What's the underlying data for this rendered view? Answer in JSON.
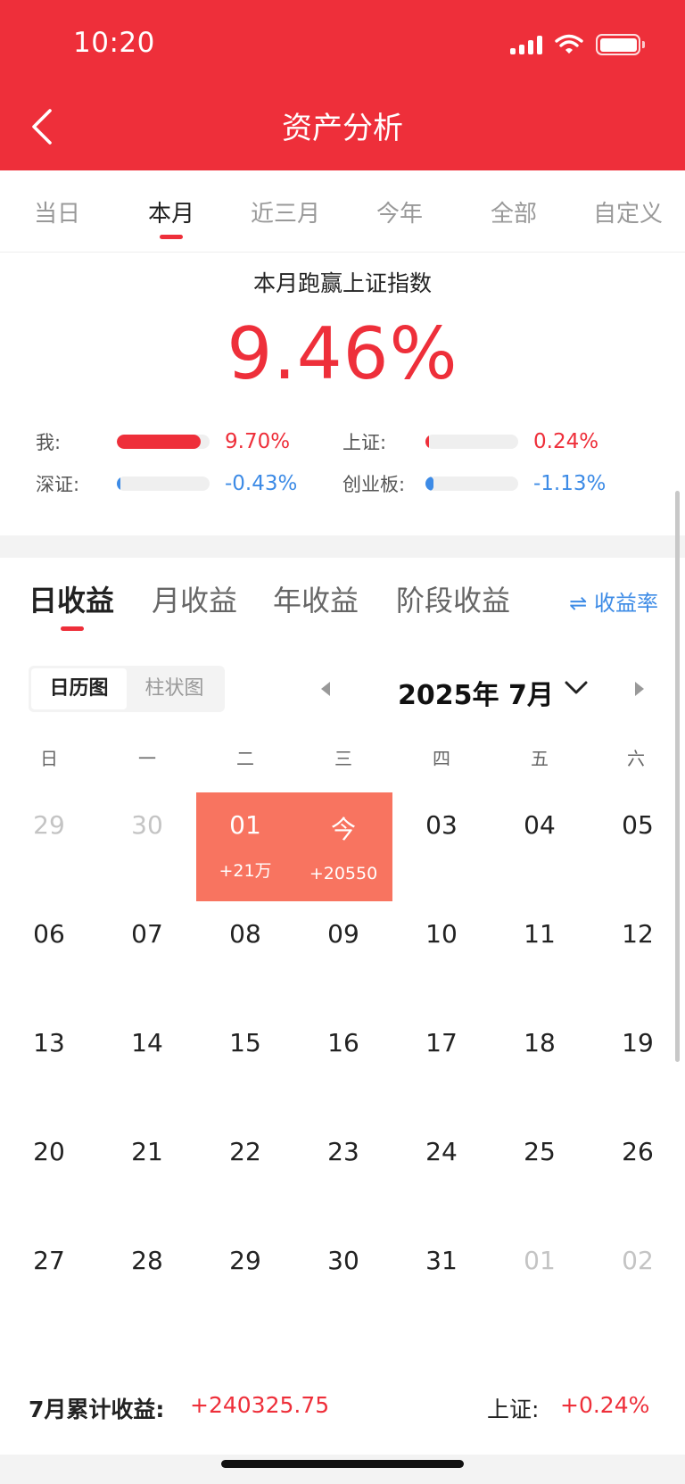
{
  "status_bar": {
    "time": "10:20"
  },
  "nav": {
    "title": "资产分析"
  },
  "period_tabs": [
    "当日",
    "本月",
    "近三月",
    "今年",
    "全部",
    "自定义"
  ],
  "summary": {
    "title": "本月跑赢上证指数",
    "value": "9.46%"
  },
  "comparisons": [
    {
      "label": "我:",
      "value": "9.70%",
      "fraction": 0.9,
      "color": "#ee2f3a"
    },
    {
      "label": "上证:",
      "value": "0.24%",
      "fraction": 0.03,
      "color": "#ee2f3a"
    },
    {
      "label": "深证:",
      "value": "-0.43%",
      "fraction": 0.03,
      "color": "#3d8be6"
    },
    {
      "label": "创业板:",
      "value": "-1.13%",
      "fraction": 0.09,
      "color": "#3d8be6"
    }
  ],
  "profit_tabs": [
    "日收益",
    "月收益",
    "年收益",
    "阶段收益"
  ],
  "rate_toggle": "⇌ 收益率",
  "view_switch": [
    "日历图",
    "柱状图"
  ],
  "calendar": {
    "month_label": "2025年 7月",
    "weekdays": [
      "日",
      "一",
      "二",
      "三",
      "四",
      "五",
      "六"
    ],
    "weeks": [
      [
        "29",
        "30",
        "01",
        "今",
        "03",
        "04",
        "05"
      ],
      [
        "06",
        "07",
        "08",
        "09",
        "10",
        "11",
        "12"
      ],
      [
        "13",
        "14",
        "15",
        "16",
        "17",
        "18",
        "19"
      ],
      [
        "20",
        "21",
        "22",
        "23",
        "24",
        "25",
        "26"
      ],
      [
        "27",
        "28",
        "29",
        "30",
        "31",
        "01",
        "02"
      ]
    ],
    "profits": {
      "0-2": "+21万",
      "0-3": "+20550"
    }
  },
  "footer": {
    "month_label": "7月累计收益:",
    "month_value": "+240325.75",
    "sh_label": "上证:",
    "sh_value": "+0.24%"
  },
  "colors": {
    "brand_red": "#ee2f3a",
    "highlight": "#f87460",
    "blue": "#3d8be6"
  }
}
